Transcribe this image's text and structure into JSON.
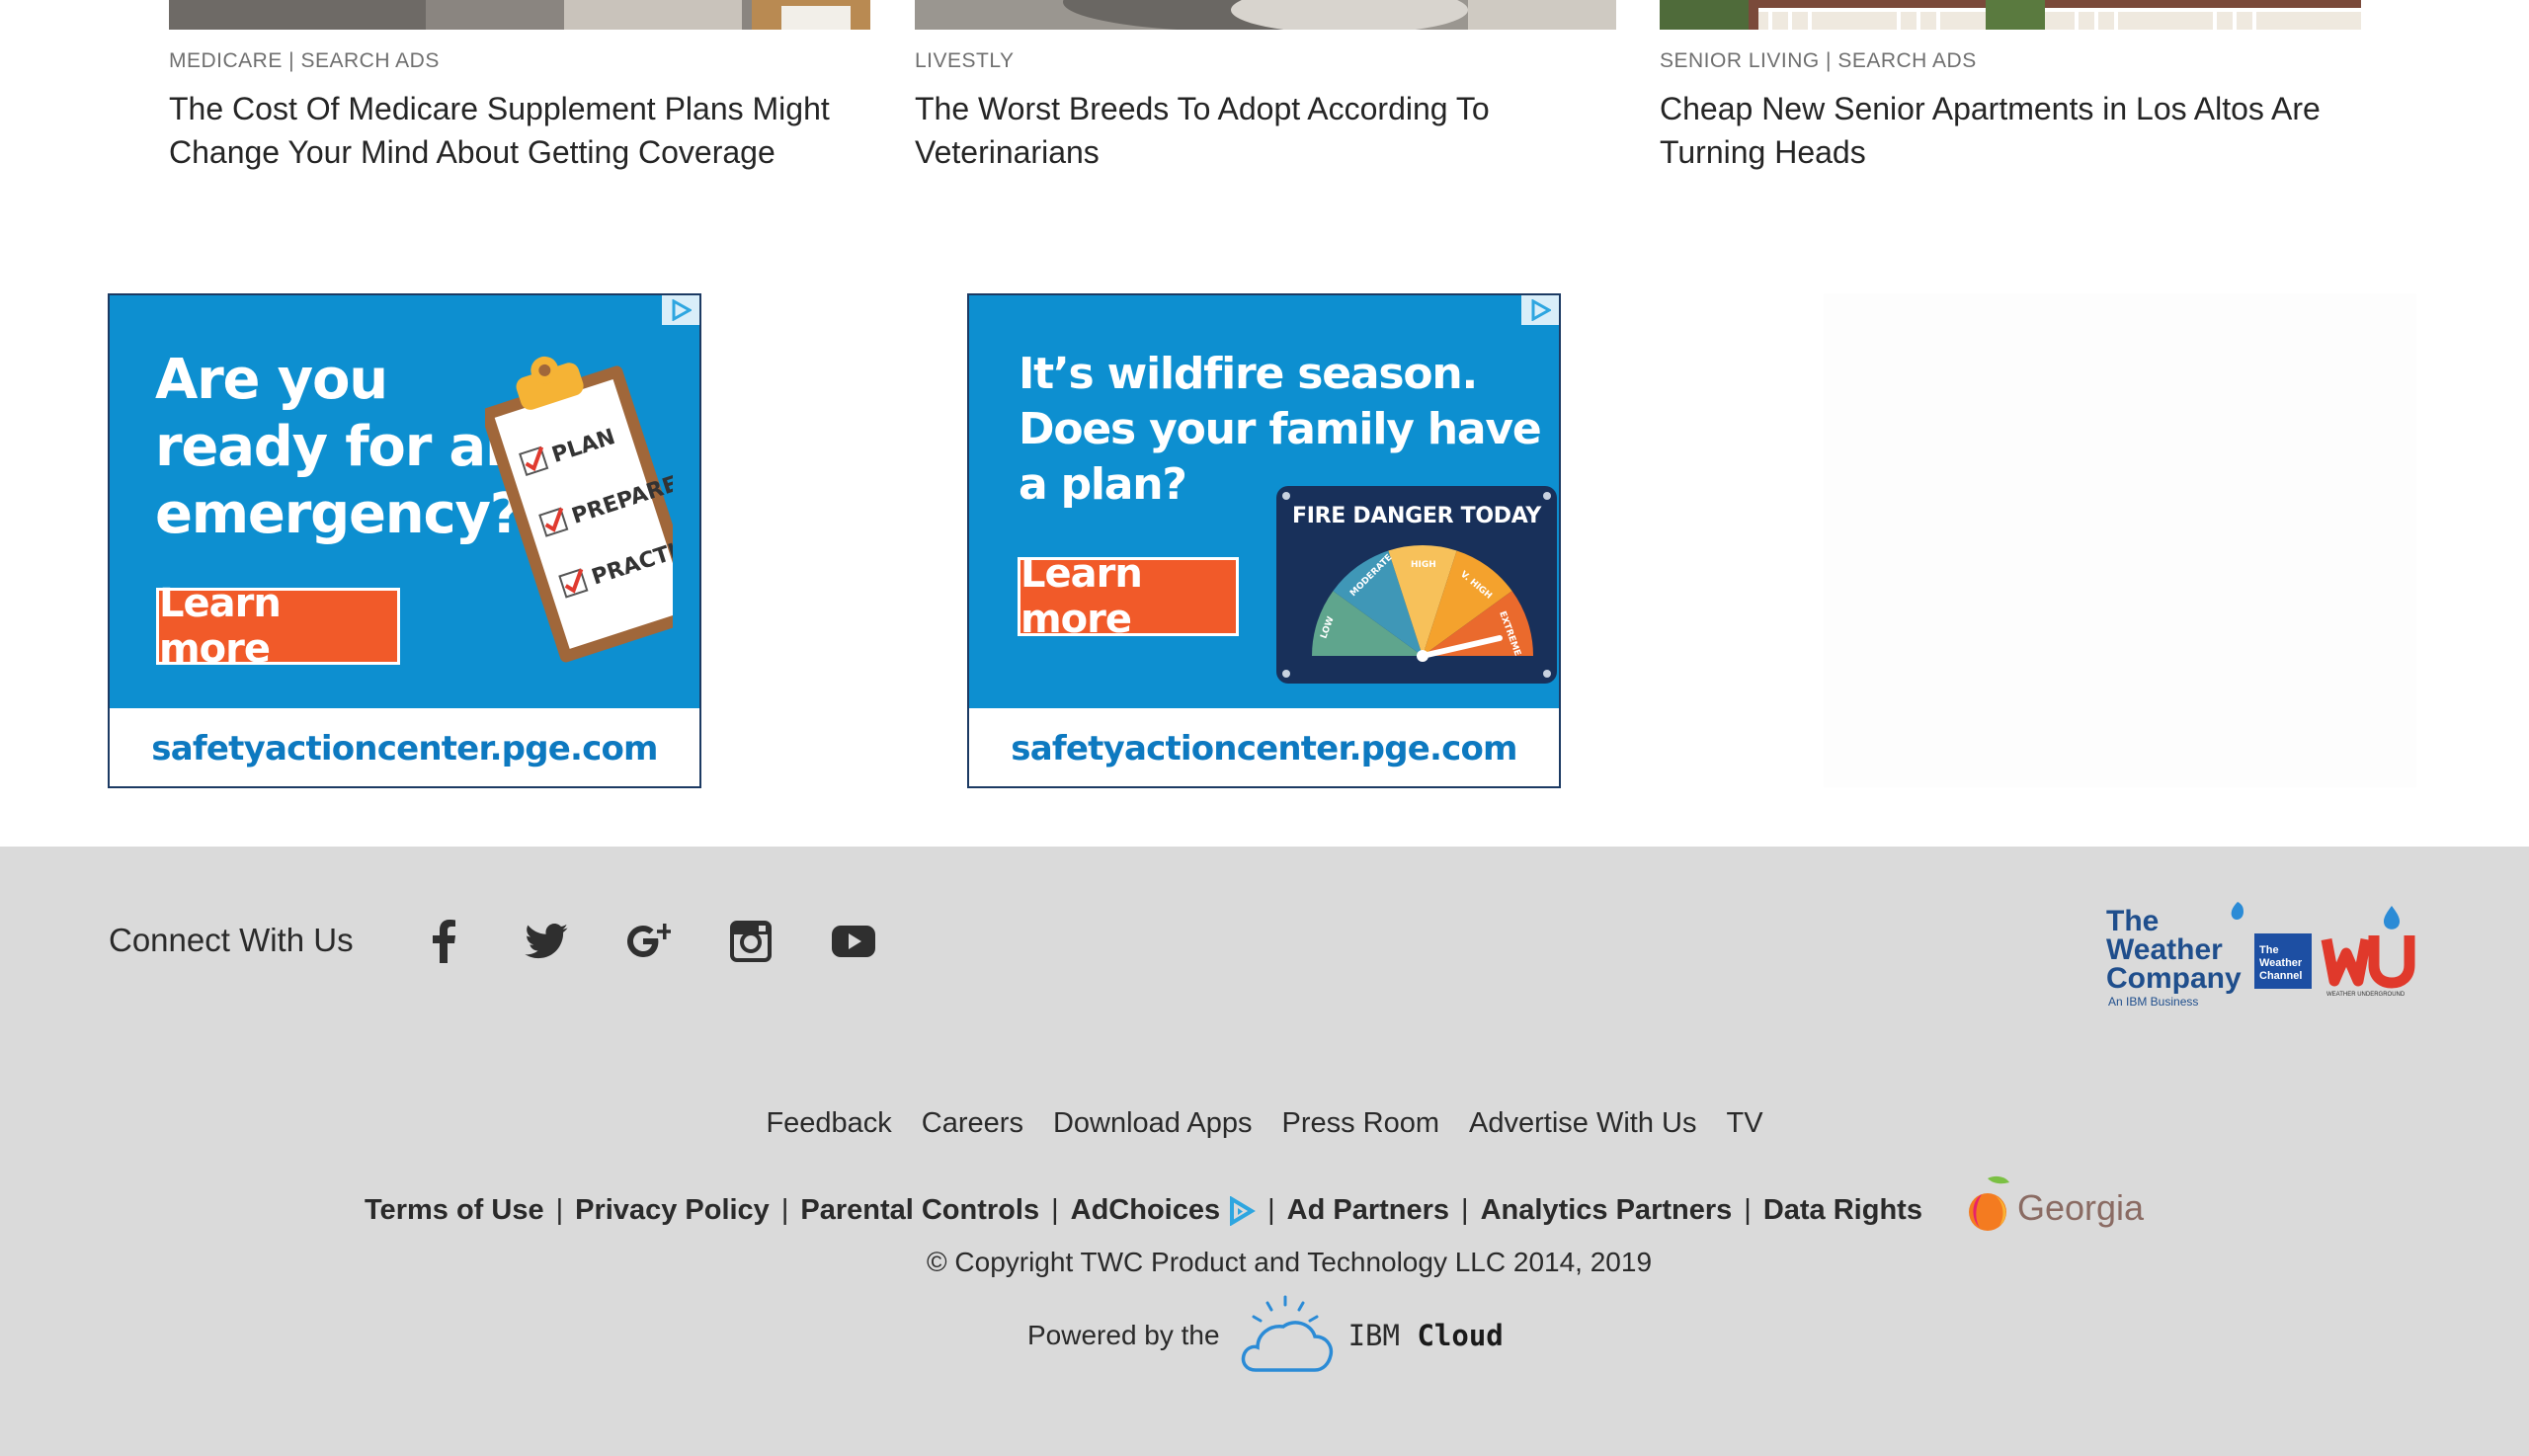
{
  "articles": [
    {
      "meta": "MEDICARE | SEARCH ADS",
      "title": "The Cost Of Medicare Supplement Plans Might Change Your Mind About Getting Coverage"
    },
    {
      "meta": "LIVESTLY",
      "title": "The Worst Breeds To Adopt According To Veterinarians"
    },
    {
      "meta": "SENIOR LIVING | SEARCH ADS",
      "title": "Cheap New Senior Apartments in Los Altos Are Turning Heads"
    }
  ],
  "ads": [
    {
      "headline": [
        "Are you",
        "ready for an",
        "emergency?"
      ],
      "cta": "Learn more",
      "url": "safetyactioncenter.pge.com",
      "checklist": [
        "PLAN",
        "PREPARE",
        "PRACTICE"
      ]
    },
    {
      "headline": [
        "It’s wildfire season.",
        "Does your family have",
        "a plan?"
      ],
      "cta": "Learn more",
      "url": "safetyactioncenter.pge.com",
      "gauge_title": "FIRE DANGER TODAY",
      "gauge_labels": [
        "LOW",
        "MODERATE",
        "HIGH",
        "V. HIGH",
        "EXTREME"
      ]
    }
  ],
  "footer": {
    "connect_label": "Connect With Us",
    "social": [
      "facebook-icon",
      "twitter-icon",
      "google-plus-icon",
      "instagram-icon",
      "youtube-icon"
    ],
    "brands": {
      "twc": [
        "The",
        "Weather",
        "Company"
      ],
      "twc_sub": "An IBM Business",
      "channel": [
        "The",
        "Weather",
        "Channel"
      ],
      "wu_sub": "WEATHER UNDERGROUND"
    },
    "links_primary": [
      "Feedback",
      "Careers",
      "Download Apps",
      "Press Room",
      "Advertise With Us",
      "TV"
    ],
    "links_secondary": [
      "Terms of Use",
      "Privacy Policy",
      "Parental Controls",
      "AdChoices",
      "Ad Partners",
      "Analytics Partners",
      "Data Rights"
    ],
    "georgia": "Georgia",
    "copyright": "© Copyright TWC Product and Technology LLC 2014, 2019",
    "powered_by": "Powered by the",
    "ibm": "IBM",
    "cloud": "Cloud"
  },
  "colors": {
    "ad_blue": "#0d8fd0",
    "ad_orange": "#f15a29",
    "footer_bg": "#dadada",
    "twc_blue": "#1f4e8c"
  }
}
